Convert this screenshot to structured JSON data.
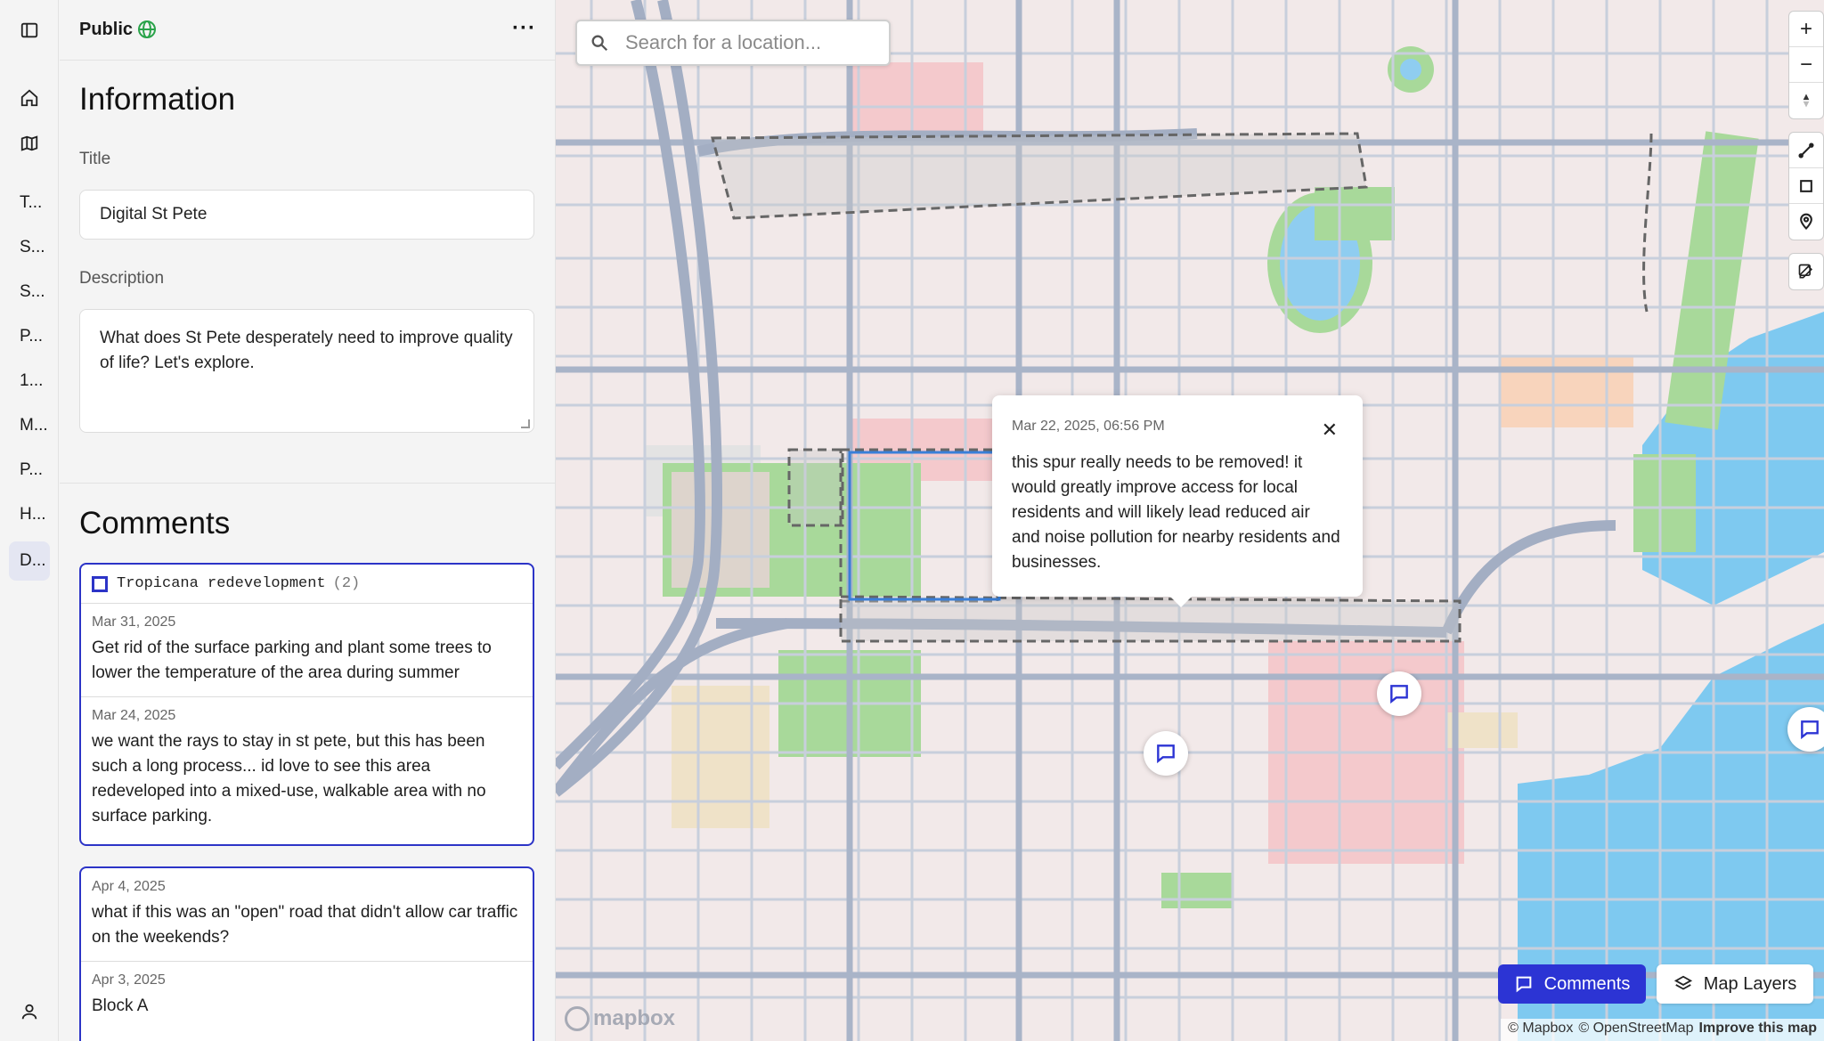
{
  "panel": {
    "visibility_label": "Public",
    "info_heading": "Information",
    "title_label": "Title",
    "title_value": "Digital St Pete",
    "description_label": "Description",
    "description_value": "What does St Pete desperately need to improve quality of life? Let's explore.",
    "comments_heading": "Comments"
  },
  "rail": {
    "items": [
      "T...",
      "S...",
      "S...",
      "P...",
      "1...",
      "M...",
      "P...",
      "H...",
      "D..."
    ]
  },
  "comment_groups": [
    {
      "title": "Tropicana redevelopment",
      "count": "(2)",
      "items": [
        {
          "date": "Mar 31, 2025",
          "text": "Get rid of the surface parking and plant some trees to lower the temperature of the area during summer"
        },
        {
          "date": "Mar 24, 2025",
          "text": "we want the rays to stay in st pete, but this has been such a long process... id love to see this area redeveloped into a mixed-use, walkable area with no surface parking."
        }
      ]
    },
    {
      "items": [
        {
          "date": "Apr 4, 2025",
          "text": "what if this was an \"open\" road that didn't allow car traffic on the weekends?"
        },
        {
          "date": "Apr 3, 2025",
          "text": "Block A"
        }
      ]
    }
  ],
  "map": {
    "search_placeholder": "Search for a location...",
    "popup": {
      "date": "Mar 22, 2025, 06:56 PM",
      "text": "this spur really needs to be removed! it would greatly improve access for local residents and will likely lead reduced air and noise pollution for nearby residents and businesses."
    },
    "comments_button": "Comments",
    "layers_button": "Map Layers",
    "logo_text": "mapbox",
    "attribution": {
      "mapbox": "© Mapbox",
      "osm": "© OpenStreetMap",
      "improve": "Improve this map"
    },
    "accent_color": "#2c34d4"
  }
}
